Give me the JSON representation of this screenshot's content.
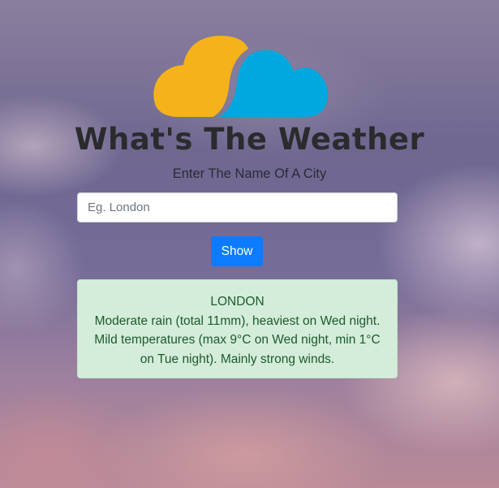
{
  "app": {
    "title": "What's The Weather",
    "subtitle": "Enter The Name Of A City"
  },
  "search": {
    "placeholder": "Eg. London",
    "value": ""
  },
  "actions": {
    "show_label": "Show"
  },
  "result": {
    "city": "LONDON",
    "forecast": "Moderate rain (total 11mm), heaviest on Wed night. Mild temperatures (max 9°C on Wed night, min 1°C on Tue night). Mainly strong winds."
  },
  "colors": {
    "logo_yellow": "#f5b21b",
    "logo_blue": "#00a8e0",
    "button_blue": "#0d7bff",
    "alert_bg": "#d4edda",
    "alert_text": "#1d5a2c"
  },
  "icons": {
    "logo": "weather-clouds-icon"
  }
}
